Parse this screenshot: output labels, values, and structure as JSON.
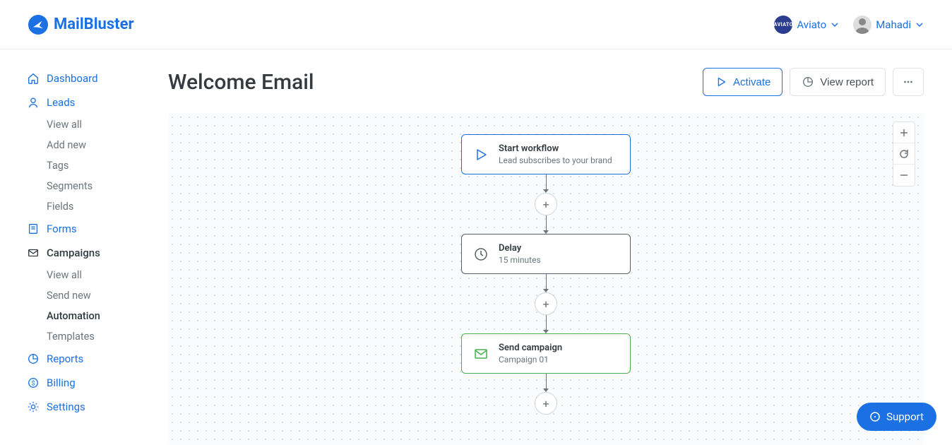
{
  "brand": {
    "name": "MailBluster"
  },
  "header": {
    "org": "Aviato",
    "user": "Mahadi"
  },
  "sidebar": {
    "dashboard": "Dashboard",
    "leads": {
      "label": "Leads",
      "items": [
        "View all",
        "Add new",
        "Tags",
        "Segments",
        "Fields"
      ]
    },
    "forms": "Forms",
    "campaigns": {
      "label": "Campaigns",
      "items": [
        "View all",
        "Send new",
        "Automation",
        "Templates"
      ]
    },
    "reports": "Reports",
    "billing": "Billing",
    "settings": "Settings"
  },
  "page": {
    "title": "Welcome Email",
    "activate": "Activate",
    "view_report": "View report"
  },
  "flow": {
    "start": {
      "title": "Start workflow",
      "sub": "Lead subscribes to your brand"
    },
    "delay": {
      "title": "Delay",
      "sub": "15 minutes"
    },
    "send": {
      "title": "Send campaign",
      "sub": "Campaign 01"
    }
  },
  "support": "Support"
}
